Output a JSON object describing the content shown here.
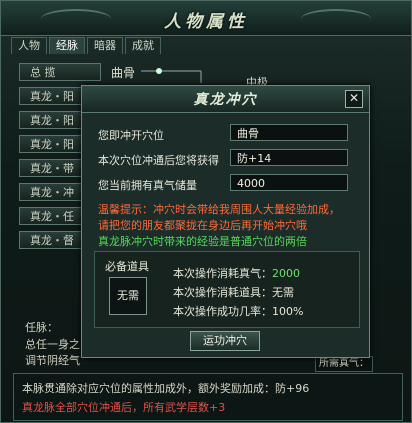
{
  "window": {
    "title": "人物属性"
  },
  "tabs": [
    {
      "label": "人物"
    },
    {
      "label": "经脉"
    },
    {
      "label": "暗器"
    },
    {
      "label": "成就"
    }
  ],
  "left_list": [
    {
      "label": "总     揽"
    },
    {
      "label": "真龙・阳"
    },
    {
      "label": "真龙・阳"
    },
    {
      "label": "真龙・阳"
    },
    {
      "label": "真龙・带"
    },
    {
      "label": "真龙・冲"
    },
    {
      "label": "真龙・任"
    },
    {
      "label": "真龙・督"
    }
  ],
  "acupoint_strip": {
    "first": "曲骨",
    "second": "中极"
  },
  "bottom": {
    "label1": "任脉：",
    "label2": "总任一身之",
    "label3": "调节阴经气",
    "field_text": "所需真气："
  },
  "info": {
    "line1": "本脉贯通除对应穴位的属性加成外，额外奖励加成：防+96",
    "line2": "真龙脉全部穴位冲通后，所有武学层数+3"
  },
  "dialog": {
    "title": "真龙冲穴",
    "close_glyph": "✕",
    "rows": [
      {
        "label": "您即冲开穴位",
        "value": "曲骨"
      },
      {
        "label": "本次穴位冲通后您将获得",
        "value": "防+14"
      },
      {
        "label": "您当前拥有真气储量",
        "value": "4000"
      }
    ],
    "warning_line1": "温馨提示：冲穴时会带给我周围人大量经验加成，",
    "warning_line2": "请把您的朋友都聚拢在身边后再开始冲穴哦",
    "note": "真龙脉冲穴时带来的经验是普通穴位的两倍",
    "section_title": "必备道具",
    "item_slot": "无需",
    "stats": [
      {
        "label": "本次操作消耗真气：",
        "value": "2000"
      },
      {
        "label": "本次操作消耗道具：",
        "value": "无需"
      },
      {
        "label": "本次操作成功几率：",
        "value": "100%"
      }
    ],
    "button": "运功冲穴"
  },
  "colors": {
    "warning": "#ff6a3a",
    "note": "#58d858",
    "stat_green": "#6ee06e",
    "info_red": "#e0524a"
  }
}
